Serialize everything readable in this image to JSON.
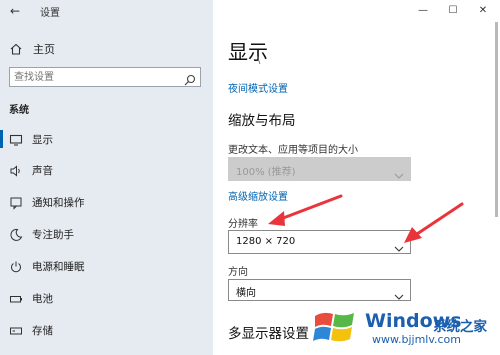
{
  "window": {
    "title": "设置",
    "back_glyph": "←",
    "minimize_glyph": "—",
    "maximize_glyph": "☐",
    "close_glyph": "✕"
  },
  "sidebar": {
    "home_label": "主页",
    "search_placeholder": "查找设置",
    "section_label": "系统",
    "items": [
      {
        "label": "显示",
        "icon": "monitor-icon",
        "active": true
      },
      {
        "label": "声音",
        "icon": "speaker-icon"
      },
      {
        "label": "通知和操作",
        "icon": "notification-icon"
      },
      {
        "label": "专注助手",
        "icon": "moon-icon"
      },
      {
        "label": "电源和睡眠",
        "icon": "power-icon"
      },
      {
        "label": "电池",
        "icon": "battery-icon"
      },
      {
        "label": "存储",
        "icon": "storage-icon"
      }
    ]
  },
  "main": {
    "page_title": "显示",
    "scroll_fragment": "\\",
    "night_light_link": "夜间模式设置",
    "scale_heading": "缩放与布局",
    "scale_label": "更改文本、应用等项目的大小",
    "scale_value": "100% (推荐)",
    "advanced_scale_link": "高级缩放设置",
    "resolution_label": "分辨率",
    "resolution_value": "1280 × 720",
    "orientation_label": "方向",
    "orientation_value": "横向",
    "multi_display_heading": "多显示器设置"
  },
  "watermark": {
    "brand": "Windows",
    "cn": "系统之家",
    "url": "www.bjjmlv.com"
  },
  "colors": {
    "sidebar_bg": "#e6ebf1",
    "accent": "#0063b1",
    "annotation_arrow": "#e8343a",
    "watermark": "#1b5fae"
  }
}
